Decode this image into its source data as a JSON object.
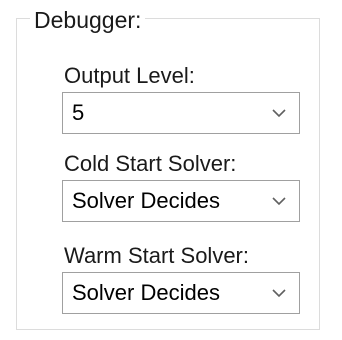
{
  "group": {
    "title": "Debugger:"
  },
  "fields": {
    "output_level": {
      "label": "Output Level:",
      "value": "5"
    },
    "cold_start_solver": {
      "label": "Cold Start Solver:",
      "value": "Solver Decides"
    },
    "warm_start_solver": {
      "label": "Warm Start Solver:",
      "value": "Solver Decides"
    }
  },
  "icons": {
    "dropdown": "chevron-down-icon"
  },
  "colors": {
    "border": "#a0a0a0",
    "group_border": "#dcdcdc",
    "text": "#1a1a1a"
  }
}
